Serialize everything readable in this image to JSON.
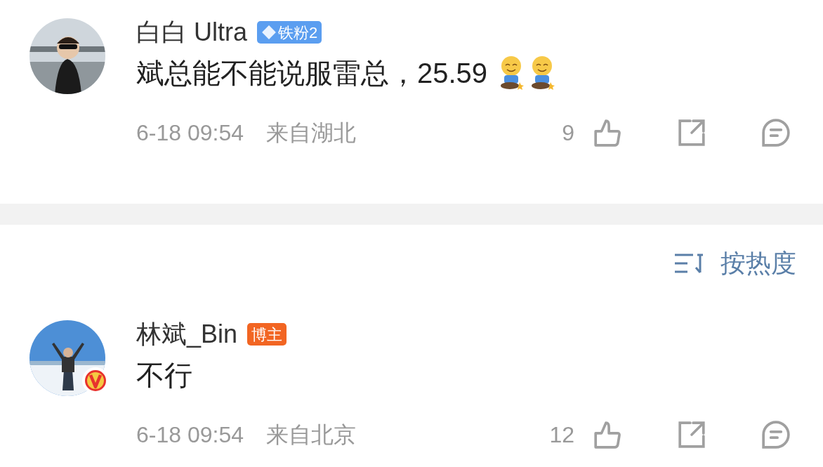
{
  "comments": [
    {
      "verified": false,
      "name": "白白 Ultra",
      "badge": {
        "kind": "fan",
        "text": "铁粉2"
      },
      "text": "斌总能不能说服雷总，25.59",
      "stickers": [
        {
          "kind": "kneeling"
        },
        {
          "kind": "kneeling"
        }
      ],
      "time": "6-18 09:54",
      "location": "来自湖北",
      "likes": "9"
    }
  ],
  "sort": {
    "label": "按热度"
  },
  "replies": [
    {
      "verified": true,
      "name": "林斌_Bin",
      "badge": {
        "kind": "author",
        "text": "博主"
      },
      "text": "不行",
      "time": "6-18 09:54",
      "location": "来自北京",
      "likes": "12"
    }
  ]
}
